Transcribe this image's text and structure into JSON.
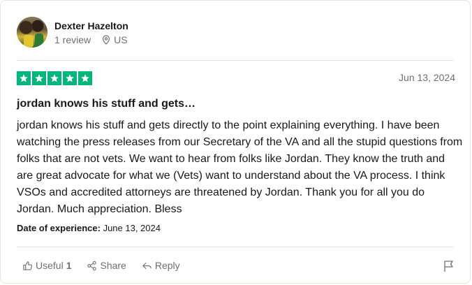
{
  "reviewer": {
    "name": "Dexter Hazelton",
    "review_count": "1 review",
    "country": "US"
  },
  "review": {
    "rating": 5,
    "date": "Jun 13, 2024",
    "title": "jordan knows his stuff and gets…",
    "body": "jordan knows his stuff and gets directly to the point explaining everything. I have been watching the press releases from our Secretary of the VA and all the stupid questions from folks that are not vets. We want to hear from folks like Jordan. They know the truth and are great advocate for what we (Vets) want to understand about the VA process. I think VSOs and accredited attorneys are threatened by Jordan. Thank you for all you do Jordan. Much appreciation. Bless",
    "experience_label": "Date of experience:",
    "experience_date": "June 13, 2024"
  },
  "actions": {
    "useful_label": "Useful",
    "useful_count": "1",
    "share_label": "Share",
    "reply_label": "Reply"
  },
  "colors": {
    "star_green": "#00b67a",
    "muted_text": "#6f6f6f",
    "divider": "#e5e5dd"
  },
  "icons": [
    "location-pin-icon",
    "star-icon",
    "thumbs-up-icon",
    "share-icon",
    "reply-icon",
    "flag-icon"
  ]
}
